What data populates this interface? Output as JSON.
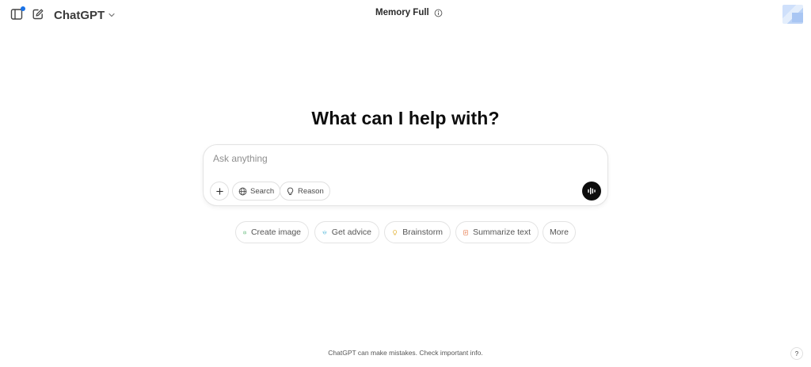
{
  "header": {
    "model_name": "ChatGPT",
    "memory_status": "Memory Full"
  },
  "main": {
    "headline": "What can I help with?",
    "composer": {
      "placeholder": "Ask anything",
      "value": "",
      "search_label": "Search",
      "reason_label": "Reason"
    },
    "suggestions": [
      {
        "label": "Create image",
        "icon": "image-icon",
        "color": "#3aa757"
      },
      {
        "label": "Get advice",
        "icon": "graduation-cap-icon",
        "color": "#4fb6d9"
      },
      {
        "label": "Brainstorm",
        "icon": "lightbulb-icon",
        "color": "#e4b43b"
      },
      {
        "label": "Summarize text",
        "icon": "document-icon",
        "color": "#e8845a"
      },
      {
        "label": "More",
        "icon": "",
        "color": ""
      }
    ]
  },
  "footer": {
    "disclaimer": "ChatGPT can make mistakes. Check important info.",
    "help_label": "?"
  },
  "colors": {
    "accent_notification": "#1a73e8",
    "voice_button": "#0d0d0d"
  }
}
